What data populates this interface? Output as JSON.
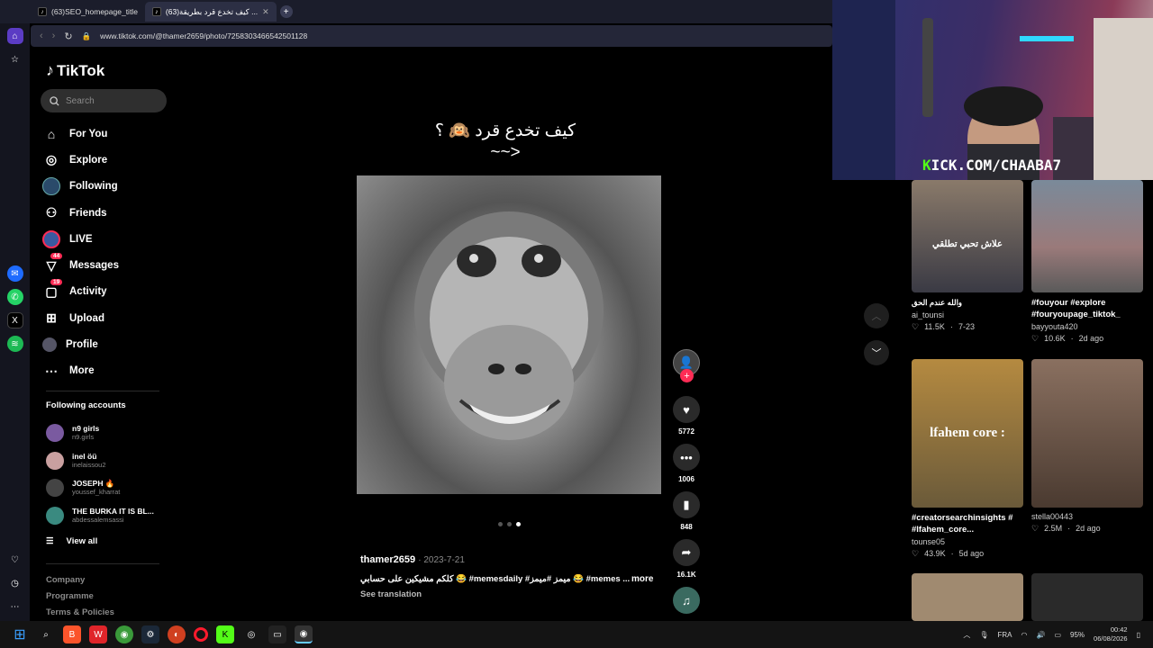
{
  "browser": {
    "tabs": [
      {
        "label": "(63)SEO_homepage_title",
        "active": false
      },
      {
        "label": "(63)كيف تخدع قرد بطريقة ...",
        "active": true
      }
    ],
    "url": "www.tiktok.com/@thamer2659/photo/7258303466542501128"
  },
  "sidebar": {
    "logo": "TikTok",
    "search_placeholder": "Search",
    "nav": [
      {
        "label": "For You",
        "icon": "home-icon"
      },
      {
        "label": "Explore",
        "icon": "compass-icon"
      },
      {
        "label": "Following",
        "icon": "following-icon"
      },
      {
        "label": "Friends",
        "icon": "friends-icon"
      },
      {
        "label": "LIVE",
        "icon": "live-icon"
      },
      {
        "label": "Messages",
        "icon": "messages-icon",
        "badge": "44"
      },
      {
        "label": "Activity",
        "icon": "activity-icon",
        "badge": "19"
      },
      {
        "label": "Upload",
        "icon": "upload-icon"
      },
      {
        "label": "Profile",
        "icon": "profile-icon"
      },
      {
        "label": "More",
        "icon": "more-icon"
      }
    ],
    "following_title": "Following accounts",
    "following": [
      {
        "name": "n9 girls",
        "handle": "n9.girls",
        "color": "#7a5aa0"
      },
      {
        "name": "inel öü",
        "handle": "inelaissou2",
        "color": "#c9a0a0"
      },
      {
        "name": "JOSEPH 🔥",
        "handle": "youssef_kharrat",
        "color": "#444"
      },
      {
        "name": "THE BURKA IT IS BL...",
        "handle": "abdessalemsassi",
        "color": "#3a8a80"
      }
    ],
    "view_all": "View all",
    "footer": [
      "Company",
      "Programme",
      "Terms & Policies"
    ]
  },
  "post": {
    "caption_line1": "كيف تخدع قرد 🙉 ؟",
    "caption_line2": "~~>",
    "author": "thamer2659",
    "date": "2023-7-21",
    "description": "كلكم مشيكين على حسابي 😂 #memesdaily #ميمز #ميمز 😂 #memes ...",
    "more": "more",
    "see_translation": "See translation",
    "likes": "5772",
    "comments": "1006",
    "saves": "848",
    "shares": "16.1K",
    "dots": 3,
    "active_dot": 2
  },
  "stream_overlay": {
    "label": "KICK.COM/CHAABA7",
    "label_accent": "K"
  },
  "related": [
    {
      "title": "والله عندم الحق",
      "overlay": "علاش تحبي تطلقي",
      "user": "ai_tounsi",
      "likes": "11.5K",
      "date": "7-23",
      "bg": "#6a6a6a"
    },
    {
      "title": "#fouyour #explore #fouryoupage_tiktok_",
      "overlay": "",
      "user": "bayyouta420",
      "likes": "10.6K",
      "date": "2d ago",
      "bg": "#8a8a9a"
    },
    {
      "title": "#creatorsearchinsights # #lfahem_core...",
      "overlay": "lfahem core :",
      "user": "tounse05",
      "likes": "43.9K",
      "date": "5d ago",
      "bg": "#8a6a30"
    },
    {
      "title": "",
      "overlay": "",
      "user": "stella00443",
      "likes": "2.5M",
      "date": "2d ago",
      "bg": "#6a5040"
    }
  ],
  "taskbar": {
    "lang": "FRA",
    "battery": "95%",
    "time": "00:42",
    "date": "06/08/2026"
  }
}
